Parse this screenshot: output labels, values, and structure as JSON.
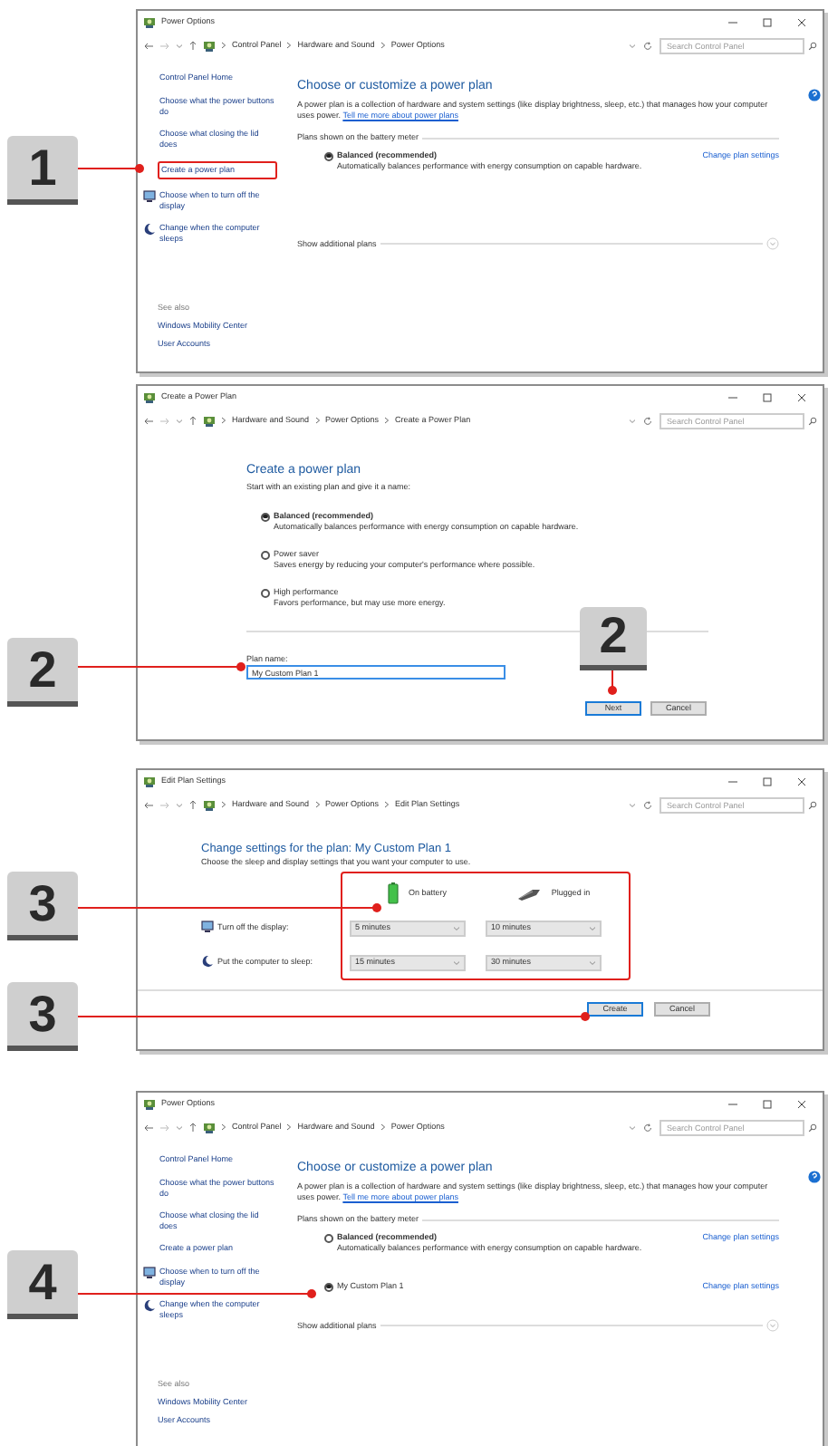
{
  "windows": [
    {
      "kind": "power_options",
      "title": "Power Options",
      "breadcrumb": [
        "Control Panel",
        "Hardware and Sound",
        "Power Options"
      ],
      "search_placeholder": "Search Control Panel",
      "sidebar": [
        {
          "label": "Control Panel Home",
          "highlighted": false
        },
        {
          "label": "Choose what the power buttons do",
          "highlighted": false
        },
        {
          "label": "Choose what closing the lid does",
          "highlighted": false
        },
        {
          "label": "Create a power plan",
          "highlighted": true
        },
        {
          "label": "Choose when to turn off the display",
          "highlighted": false
        },
        {
          "label": "Change when the computer sleeps",
          "highlighted": false
        }
      ],
      "see_also": "See also",
      "see_also_links": [
        "Windows Mobility Center",
        "User Accounts"
      ],
      "heading": "Choose or customize a power plan",
      "description": "A power plan is a collection of hardware and system settings (like display brightness, sleep, etc.) that manages how your computer uses power.",
      "more_link": "Tell me more about power plans",
      "section": "Plans shown on the battery meter",
      "plans": [
        {
          "name": "Balanced (recommended)",
          "emphasized": true,
          "selected": true,
          "description": "Automatically balances performance with energy consumption on capable hardware.",
          "link": "Change plan settings"
        }
      ],
      "show_more": "Show additional plans",
      "callouts": [
        {
          "label": "1"
        }
      ]
    },
    {
      "kind": "create_plan",
      "title": "Create a Power Plan",
      "breadcrumb": [
        "Hardware and Sound",
        "Power Options",
        "Create a Power Plan"
      ],
      "search_placeholder": "Search Control Panel",
      "heading": "Create a power plan",
      "intro": "Start with an existing plan and give it a name:",
      "options": [
        {
          "name": "Balanced (recommended)",
          "selected": true,
          "description": "Automatically balances performance with energy consumption on capable hardware."
        },
        {
          "name": "Power saver",
          "selected": false,
          "description": "Saves energy by reducing your computer's performance where possible."
        },
        {
          "name": "High performance",
          "selected": false,
          "description": "Favors performance, but may use more energy."
        }
      ],
      "plan_name_label": "Plan name:",
      "plan_name_value": "My Custom Plan 1",
      "buttons": [
        {
          "label": "Next",
          "primary": true
        },
        {
          "label": "Cancel",
          "primary": false
        }
      ],
      "callouts": [
        {
          "label": "2"
        },
        {
          "label": "2"
        }
      ]
    },
    {
      "kind": "edit_plan",
      "title": "Edit Plan Settings",
      "breadcrumb": [
        "Hardware and Sound",
        "Power Options",
        "Edit Plan Settings"
      ],
      "search_placeholder": "Search Control Panel",
      "heading": "Change settings for the plan: My Custom Plan 1",
      "intro": "Choose the sleep and display settings that you want your computer to use.",
      "columns": [
        {
          "label": "On battery"
        },
        {
          "label": "Plugged in"
        }
      ],
      "settings_highlighted": true,
      "rows": [
        {
          "label": "Turn off the display:",
          "values": [
            "5 minutes",
            "10 minutes"
          ]
        },
        {
          "label": "Put the computer to sleep:",
          "values": [
            "15 minutes",
            "30 minutes"
          ]
        }
      ],
      "buttons": [
        {
          "label": "Create",
          "primary": true
        },
        {
          "label": "Cancel",
          "primary": false
        }
      ],
      "callouts": [
        {
          "label": "3"
        },
        {
          "label": "3"
        }
      ]
    },
    {
      "kind": "power_options",
      "title": "Power Options",
      "breadcrumb": [
        "Control Panel",
        "Hardware and Sound",
        "Power Options"
      ],
      "search_placeholder": "Search Control Panel",
      "sidebar": [
        {
          "label": "Control Panel Home",
          "highlighted": false
        },
        {
          "label": "Choose what the power buttons do",
          "highlighted": false
        },
        {
          "label": "Choose what closing the lid does",
          "highlighted": false
        },
        {
          "label": "Create a power plan",
          "highlighted": false
        },
        {
          "label": "Choose when to turn off the display",
          "highlighted": false
        },
        {
          "label": "Change when the computer sleeps",
          "highlighted": false
        }
      ],
      "see_also": "See also",
      "see_also_links": [
        "Windows Mobility Center",
        "User Accounts"
      ],
      "heading": "Choose or customize a power plan",
      "description": "A power plan is a collection of hardware and system settings (like display brightness, sleep, etc.) that manages how your computer uses power.",
      "more_link": "Tell me more about power plans",
      "section": "Plans shown on the battery meter",
      "plans": [
        {
          "name": "Balanced (recommended)",
          "emphasized": true,
          "selected": false,
          "description": "Automatically balances performance with energy consumption on capable hardware.",
          "link": "Change plan settings"
        },
        {
          "name": "My Custom Plan 1",
          "emphasized": false,
          "selected": true,
          "link": "Change plan settings"
        }
      ],
      "show_more": "Show additional plans",
      "callouts": [
        {
          "label": "4"
        }
      ]
    }
  ]
}
